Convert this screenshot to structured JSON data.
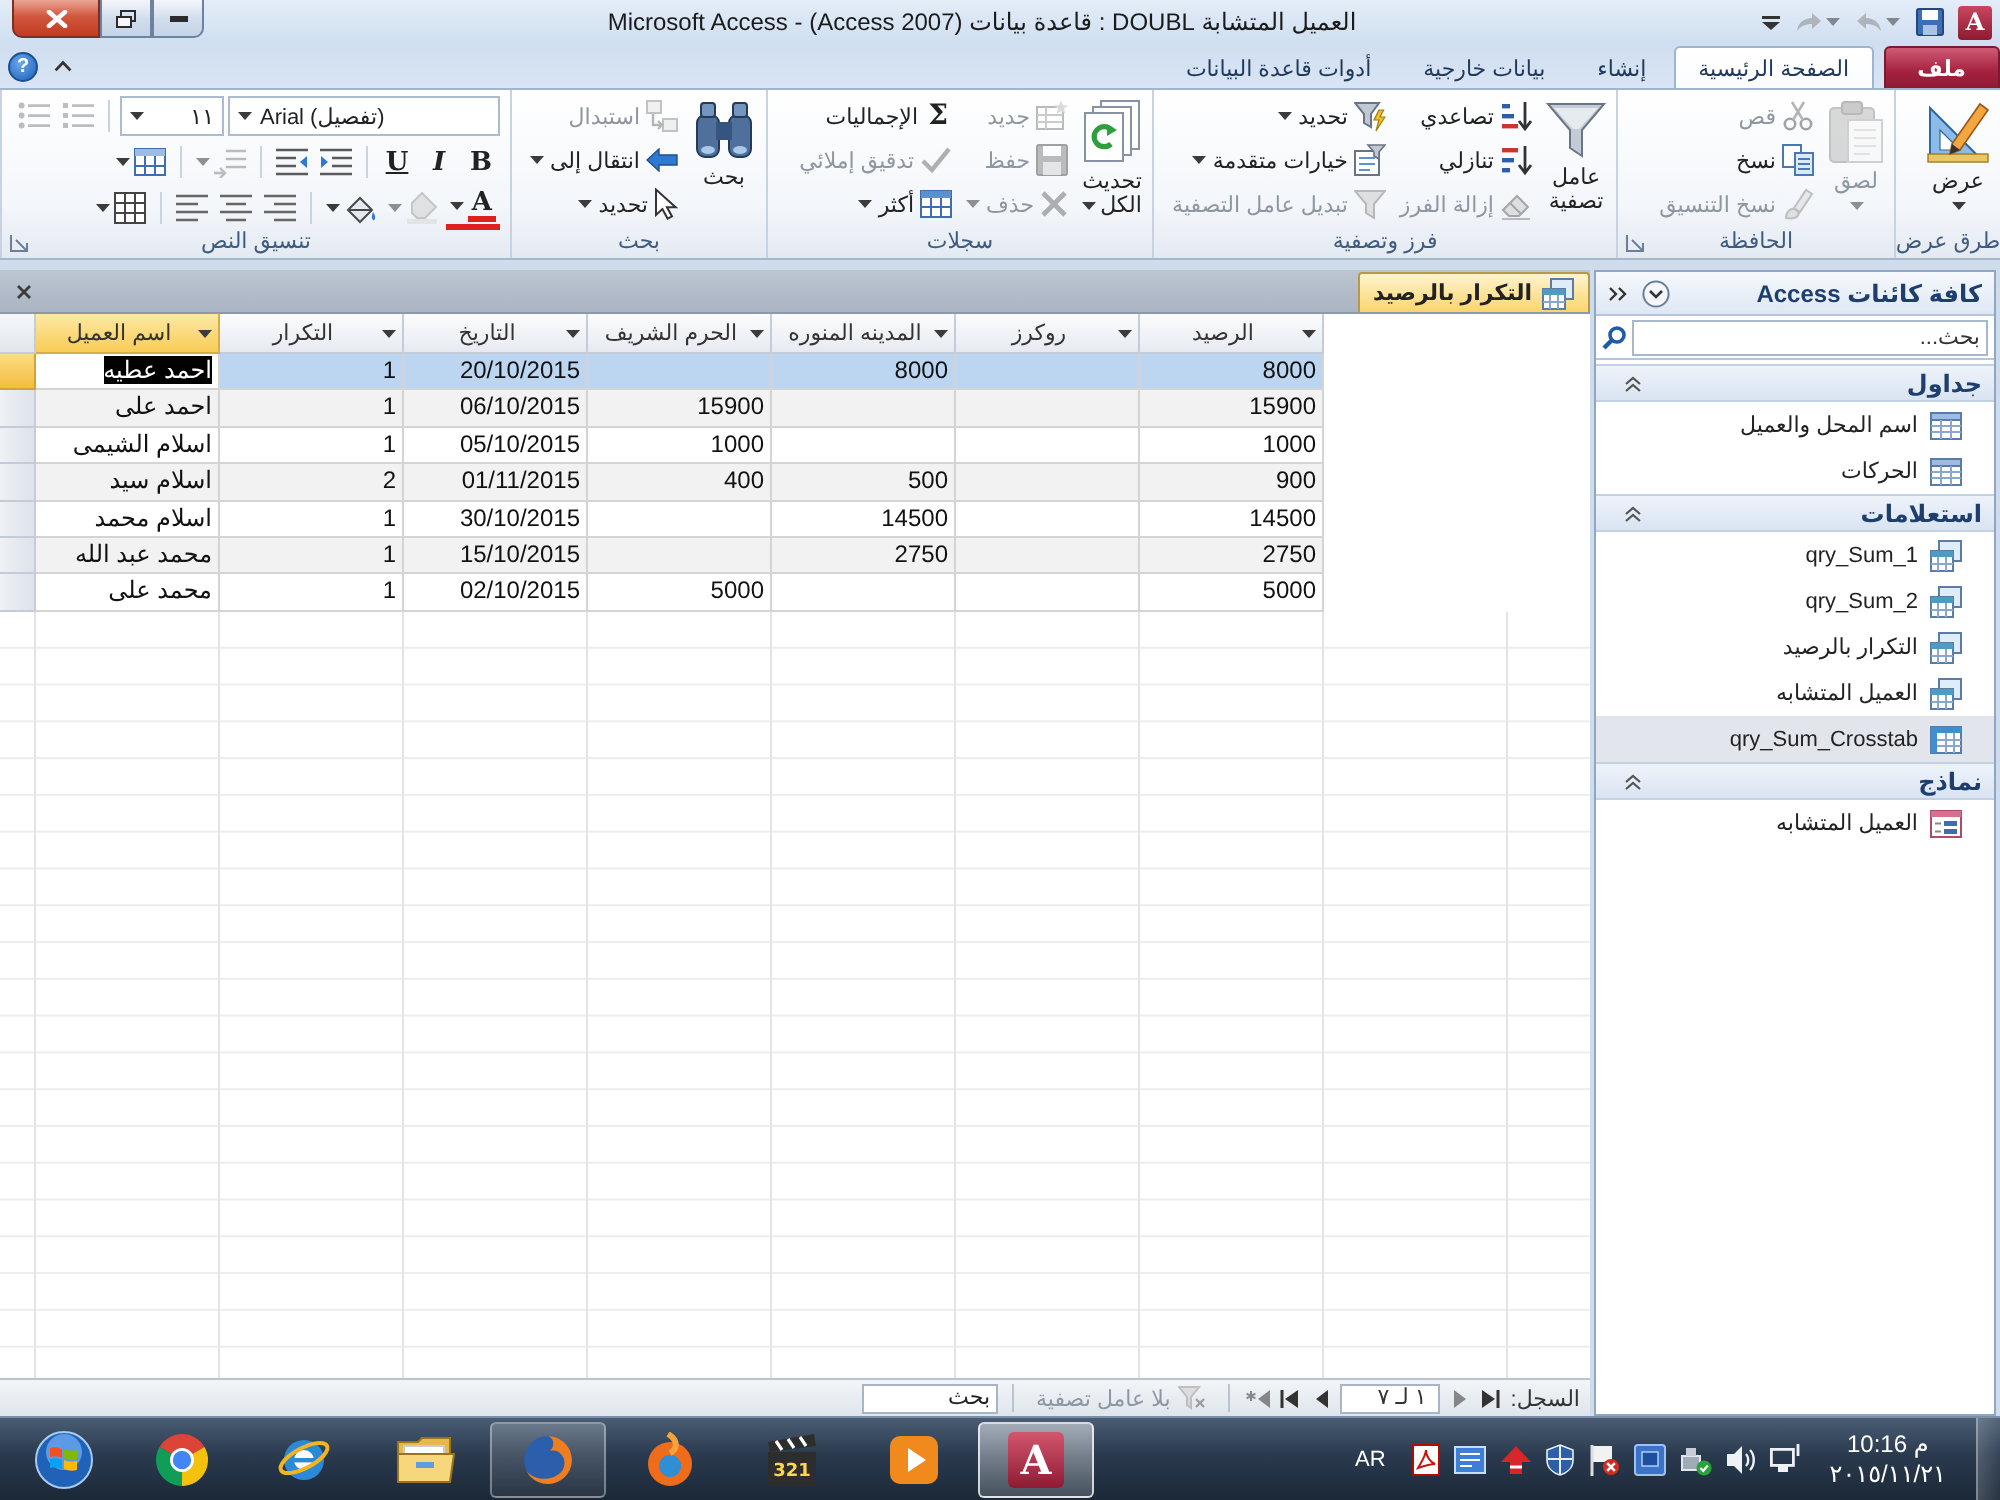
{
  "title_bar": {
    "app_icon": "A",
    "quick_access": [
      {
        "disabled": false,
        "dropdown": false
      },
      {
        "disabled": true,
        "dropdown": true
      },
      {
        "disabled": true,
        "dropdown": true
      }
    ],
    "title_parts": [
      "العميل المتشابة DOUBL",
      ":",
      "قاعدة بيانات (Access 2007)",
      "-",
      "Microsoft Access"
    ]
  },
  "ribbon": {
    "tabs": [
      {
        "label": "ملف",
        "kind": "file",
        "selected": false
      },
      {
        "label": "الصفحة الرئيسية",
        "kind": "tab",
        "selected": true
      },
      {
        "label": "إنشاء",
        "kind": "tab",
        "selected": false
      },
      {
        "label": "بيانات خارجية",
        "kind": "tab",
        "selected": false
      },
      {
        "label": "أدوات قاعدة البيانات",
        "kind": "tab",
        "selected": false
      }
    ],
    "help": "?",
    "groups": [
      {
        "label": "طرق عرض",
        "launcher": false,
        "items": [
          {
            "kind": "large",
            "label": "عرض",
            "disabled": false,
            "dropdown": true
          }
        ]
      },
      {
        "label": "الحافظة",
        "launcher": true,
        "items": [
          {
            "kind": "large",
            "label": "لصق",
            "disabled": true,
            "dropdown": true
          },
          {
            "kind": "column",
            "buttons": [
              {
                "label": "قص",
                "disabled": true,
                "dropdown": false
              },
              {
                "label": "نسخ",
                "disabled": false,
                "dropdown": false
              },
              {
                "label": "نسخ التنسيق",
                "disabled": true,
                "dropdown": false
              }
            ]
          }
        ]
      },
      {
        "label": "فرز وتصفية",
        "launcher": false,
        "items": [
          {
            "kind": "large",
            "label": "عامل تصفية",
            "disabled": false,
            "dropdown": false
          },
          {
            "kind": "column",
            "buttons": [
              {
                "label": "تصاعدي",
                "disabled": false,
                "dropdown": false
              },
              {
                "label": "تنازلي",
                "disabled": false,
                "dropdown": false
              },
              {
                "label": "إزالة الفرز",
                "disabled": true,
                "dropdown": false
              }
            ]
          },
          {
            "kind": "column",
            "buttons": [
              {
                "label": "تحديد",
                "disabled": false,
                "dropdown": true
              },
              {
                "label": "خيارات متقدمة",
                "disabled": false,
                "dropdown": true
              },
              {
                "label": "تبديل عامل التصفية",
                "disabled": true,
                "dropdown": false
              }
            ]
          }
        ]
      },
      {
        "label": "سجلات",
        "launcher": false,
        "items": [
          {
            "kind": "large",
            "label": "تحديث الكل",
            "disabled": false,
            "dropdown": true
          },
          {
            "kind": "column",
            "buttons": [
              {
                "label": "جديد",
                "disabled": true,
                "dropdown": false
              },
              {
                "label": "حفظ",
                "disabled": true,
                "dropdown": false
              },
              {
                "label": "حذف",
                "disabled": true,
                "dropdown": true
              }
            ]
          },
          {
            "kind": "column",
            "buttons": [
              {
                "label": "الإجماليات",
                "glyph": "Σ",
                "disabled": false,
                "dropdown": false
              },
              {
                "label": "تدقيق إملائي",
                "disabled": true,
                "dropdown": false
              },
              {
                "label": "أكثر",
                "disabled": false,
                "dropdown": true
              }
            ]
          }
        ]
      },
      {
        "label": "بحث",
        "launcher": false,
        "items": [
          {
            "kind": "large",
            "label": "بحث",
            "disabled": false,
            "dropdown": false
          },
          {
            "kind": "column",
            "buttons": [
              {
                "label": "استبدال",
                "disabled": true,
                "dropdown": false
              },
              {
                "label": "انتقال إلى",
                "disabled": false,
                "dropdown": true
              },
              {
                "label": "تحديد",
                "disabled": false,
                "dropdown": true
              }
            ]
          }
        ]
      },
      {
        "label": "تنسيق النص",
        "launcher": true,
        "items": [
          {
            "kind": "rows",
            "rows": [
              [
                {
                  "kind": "combo",
                  "value": "Arial (تفصيل)"
                },
                {
                  "kind": "combo",
                  "value": "١١"
                },
                {
                  "kind": "icon",
                  "disabled": true,
                  "dropdown": false
                },
                {
                  "kind": "icon",
                  "disabled": true,
                  "dropdown": false
                }
              ],
              [
                {
                  "kind": "text",
                  "label": "B",
                  "disabled": false,
                  "dropdown": false
                },
                {
                  "kind": "text",
                  "label": "I",
                  "disabled": false,
                  "dropdown": false
                },
                {
                  "kind": "text",
                  "label": "U",
                  "disabled": false,
                  "dropdown": false
                },
                {
                  "kind": "icon",
                  "disabled": false,
                  "dropdown": false
                },
                {
                  "kind": "icon",
                  "disabled": false,
                  "dropdown": false
                },
                {
                  "kind": "icon",
                  "disabled": true,
                  "dropdown": true
                },
                {
                  "kind": "icon",
                  "disabled": false,
                  "dropdown": true
                }
              ],
              [
                {
                  "kind": "text",
                  "label": "A",
                  "disabled": false,
                  "dropdown": true
                },
                {
                  "kind": "icon",
                  "disabled": true,
                  "dropdown": true
                },
                {
                  "kind": "icon",
                  "disabled": false,
                  "dropdown": true
                },
                {
                  "kind": "icon",
                  "disabled": false,
                  "dropdown": false
                },
                {
                  "kind": "icon",
                  "disabled": false,
                  "dropdown": false
                },
                {
                  "kind": "icon",
                  "disabled": false,
                  "dropdown": false
                },
                {
                  "kind": "icon",
                  "disabled": false,
                  "dropdown": true
                }
              ]
            ]
          }
        ]
      }
    ]
  },
  "document": {
    "tabs": [
      {
        "label": "التكرار بالرصيد",
        "selected": true
      }
    ],
    "datasheet": {
      "columns": [
        {
          "label": "الرصيد",
          "selected": false
        },
        {
          "label": "روكرز",
          "selected": false
        },
        {
          "label": "المدينه المنوره",
          "selected": false
        },
        {
          "label": "الحرم الشريف",
          "selected": false
        },
        {
          "label": "التاريخ",
          "selected": false
        },
        {
          "label": "التكرار",
          "selected": false
        },
        {
          "label": "اسم العميل",
          "selected": true
        }
      ],
      "rows": [
        {
          "selected": true,
          "cells": [
            "8000",
            null,
            "8000",
            null,
            "20/10/2015",
            "1",
            "احمد عطيه"
          ]
        },
        {
          "selected": false,
          "cells": [
            "15900",
            null,
            null,
            "15900",
            "06/10/2015",
            "1",
            "احمد على"
          ]
        },
        {
          "selected": false,
          "cells": [
            "1000",
            null,
            null,
            "1000",
            "05/10/2015",
            "1",
            "اسلام الشيمى"
          ]
        },
        {
          "selected": false,
          "cells": [
            "900",
            null,
            "500",
            "400",
            "01/11/2015",
            "2",
            "اسلام سيد"
          ]
        },
        {
          "selected": false,
          "cells": [
            "14500",
            null,
            "14500",
            null,
            "30/10/2015",
            "1",
            "اسلام محمد"
          ]
        },
        {
          "selected": false,
          "cells": [
            "2750",
            null,
            "2750",
            null,
            "15/10/2015",
            "1",
            "محمد عبد الله"
          ]
        },
        {
          "selected": false,
          "cells": [
            "5000",
            null,
            null,
            "5000",
            "02/10/2015",
            "1",
            "محمد على"
          ]
        }
      ]
    },
    "record_nav": {
      "label": "السجل:",
      "back_buttons": [
        {
          "disabled": false
        },
        {
          "disabled": true
        }
      ],
      "position": "١ لـ ٧",
      "forward_buttons": [
        {
          "disabled": false
        },
        {
          "disabled": false
        },
        {
          "disabled": true
        }
      ],
      "filter": {
        "label": "بلا عامل تصفية",
        "disabled": true
      },
      "search": {
        "placeholder": "بحث"
      }
    }
  },
  "nav_pane": {
    "title": "كافة كائنات Access",
    "search": {
      "placeholder": "بحث..."
    },
    "groups": [
      {
        "label": "جداول",
        "expanded": true,
        "items": [
          {
            "label": "اسم المحل والعميل",
            "kind": "table",
            "selected": false
          },
          {
            "label": "الحركات",
            "kind": "table",
            "selected": false
          }
        ]
      },
      {
        "label": "استعلامات",
        "expanded": true,
        "items": [
          {
            "label": "qry_Sum_1",
            "kind": "query",
            "selected": false
          },
          {
            "label": "qry_Sum_2",
            "kind": "query",
            "selected": false
          },
          {
            "label": "التكرار بالرصيد",
            "kind": "query",
            "selected": false
          },
          {
            "label": "العميل المتشابه",
            "kind": "query",
            "selected": false
          },
          {
            "label": "qry_Sum_Crosstab",
            "kind": "crosstab",
            "selected": true
          }
        ]
      },
      {
        "label": "نماذج",
        "expanded": true,
        "items": [
          {
            "label": "العميل المتشابه",
            "kind": "form",
            "selected": false
          }
        ]
      }
    ]
  },
  "taskbar": {
    "tray": {
      "time": "10:16 م",
      "date": "٢٠١٥/١١/٢١",
      "language": "AR"
    },
    "apps": [
      {
        "glyph": "A",
        "running": true,
        "selected": true
      },
      {
        "running": false,
        "selected": false
      },
      {
        "label": "321",
        "running": false,
        "selected": false
      },
      {
        "running": false,
        "selected": false
      },
      {
        "running": true,
        "selected": false
      },
      {
        "running": false,
        "selected": false
      },
      {
        "running": false,
        "selected": false
      },
      {
        "running": false,
        "selected": false
      }
    ]
  }
}
